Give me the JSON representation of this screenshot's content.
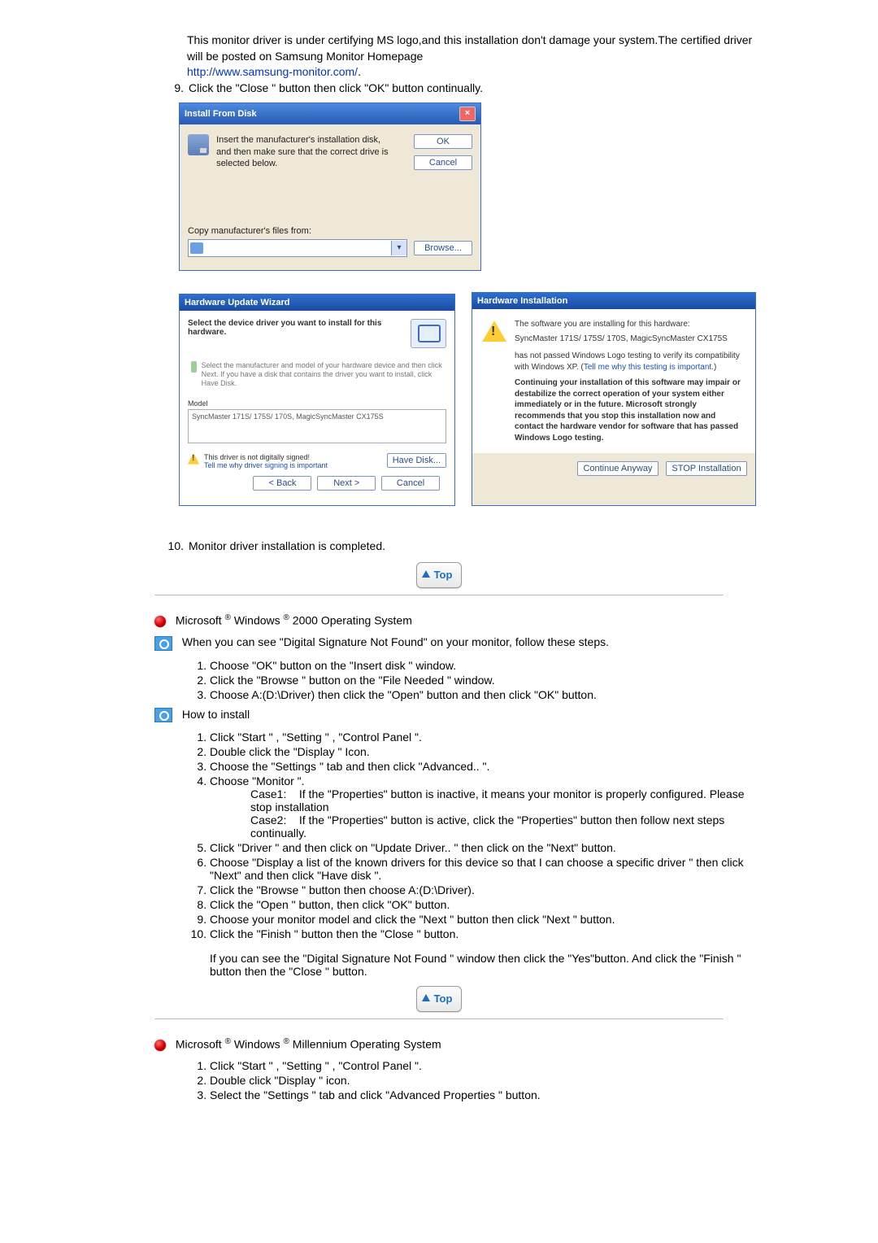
{
  "intro": {
    "p1a": "This monitor driver is under certifying MS logo,and this installation don't damage your system.The certified driver will be posted on Samsung Monitor Homepage",
    "link": "http://www.samsung-monitor.com/",
    "link_period": ".",
    "step9_num": "9.",
    "step9": "Click the \"Close \" button then click \"OK\" button continually."
  },
  "ifd": {
    "title": "Install From Disk",
    "msg": "Insert the manufacturer's installation disk, and then make sure that the correct drive is selected below.",
    "ok": "OK",
    "cancel": "Cancel",
    "copy_label": "Copy manufacturer's files from:",
    "browse": "Browse..."
  },
  "huw": {
    "title": "Hardware Update Wizard",
    "heading": "Select the device driver you want to install for this hardware.",
    "mid": "Select the manufacturer and model of your hardware device and then click Next. If you have a disk that contains the driver you want to install, click Have Disk.",
    "model_lbl": "Model",
    "model_item": "SyncMaster 171S/ 175S/ 170S, MagicSyncMaster CX175S",
    "warn_a": "This driver is not digitally signed!",
    "warn_b": "Tell me why driver signing is important",
    "have_disk": "Have Disk...",
    "back": "< Back",
    "next": "Next >",
    "cancel": "Cancel"
  },
  "hinst": {
    "title": "Hardware Installation",
    "l1": "The software you are installing for this hardware:",
    "l2": "SyncMaster 171S/ 175S/ 170S, MagicSyncMaster CX175S",
    "l3a": "has not passed Windows Logo testing to verify its compatibility with Windows XP. (",
    "l3link": "Tell me why this testing is important.",
    "l3b": ")",
    "bold": "Continuing your installation of this software may impair or destabilize the correct operation of your system either immediately or in the future. Microsoft strongly recommends that you stop this installation now and contact the hardware vendor for software that has passed Windows Logo testing.",
    "cont": "Continue Anyway",
    "stop": "STOP Installation"
  },
  "after": {
    "step10_num": "10.",
    "step10": "Monitor driver installation is completed."
  },
  "top_label": "Top",
  "w2000": {
    "heading_a": "Microsoft",
    "heading_b": "Windows",
    "heading_c": "2000 Operating System",
    "reg": "®",
    "sig_line": "When you can see \"Digital Signature Not Found\" on your monitor, follow these steps.",
    "sig_steps": [
      "Choose \"OK\" button on the \"Insert disk \" window.",
      "Click the \"Browse \" button on the \"File Needed \" window.",
      "Choose A:(D:\\Driver) then click the \"Open\" button and then click \"OK\" button."
    ],
    "how_label": "How to install",
    "inst": {
      "s1": "Click \"Start \" , \"Setting \" , \"Control Panel \".",
      "s2": "Double click the \"Display \" Icon.",
      "s3": "Choose the \"Settings \" tab and then click \"Advanced.. \".",
      "s4": "Choose \"Monitor \".",
      "c1lbl": "Case1:",
      "c1": "If the \"Properties\" button is inactive, it means your monitor is properly configured. Please stop installation",
      "c2lbl": "Case2:",
      "c2": "If the \"Properties\" button is active, click the \"Properties\" button then follow next steps continually.",
      "s5": "Click \"Driver \" and then click on \"Update Driver.. \" then click on the \"Next\" button.",
      "s6": "Choose \"Display a list of the known drivers for this device so that I can choose a specific driver \" then click \"Next\" and then click \"Have disk \".",
      "s7": "Click the \"Browse \" button then choose A:(D:\\Driver).",
      "s8": "Click the \"Open \" button, then click \"OK\" button.",
      "s9": "Choose your monitor model and click the \"Next \" button then click \"Next \" button.",
      "s10": "Click the \"Finish \" button then the \"Close \" button.",
      "tail": "If you can see the \"Digital Signature Not Found \" window then click the \"Yes\"button. And click the \"Finish \" button then the \"Close \" button."
    }
  },
  "wme": {
    "heading_a": "Microsoft",
    "heading_b": "Windows",
    "heading_c": "Millennium Operating System",
    "steps": [
      "Click \"Start \" , \"Setting \" , \"Control Panel \".",
      "Double click \"Display \" icon.",
      "Select the \"Settings \" tab and click \"Advanced Properties \" button."
    ]
  }
}
